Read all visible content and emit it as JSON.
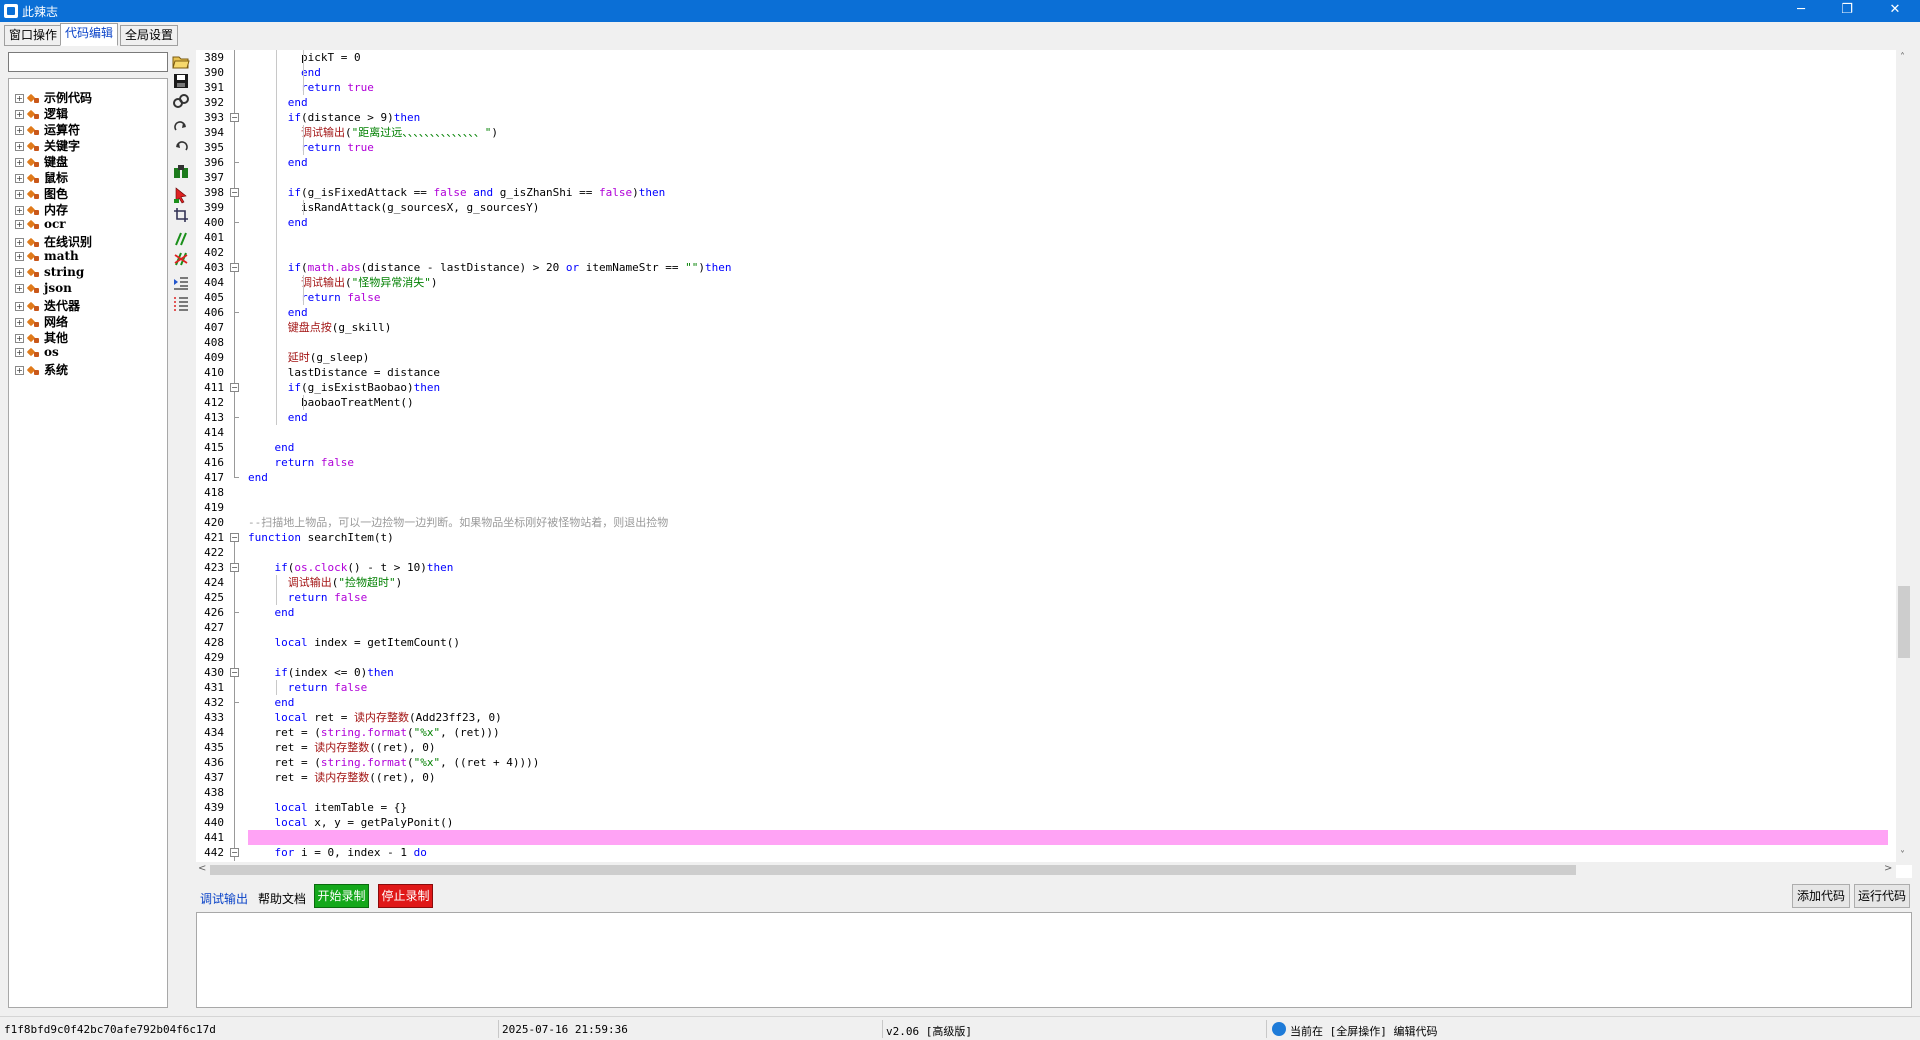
{
  "window": {
    "title": "此辣志",
    "min": "─",
    "max": "❐",
    "close": "✕"
  },
  "tabs": [
    {
      "label": "窗口操作",
      "active": false
    },
    {
      "label": "代码编辑",
      "active": true
    },
    {
      "label": "全局设置",
      "active": false
    }
  ],
  "sidebar": {
    "search_value": "",
    "tree_items": [
      "示例代码",
      "逻辑",
      "运算符",
      "关键字",
      "键盘",
      "鼠标",
      "图色",
      "内存",
      "ocr",
      "在线识别",
      "math",
      "string",
      "json",
      "迭代器",
      "网络",
      "其他",
      "os",
      "系统"
    ]
  },
  "toolbar_icons": [
    "open-icon",
    "save-icon",
    "link-icon",
    "redo-icon",
    "undo-icon",
    "find-icon",
    "pointer-icon",
    "crop-icon",
    "comment-icon",
    "uncomment-icon",
    "indent-icon",
    "list-icon"
  ],
  "editor": {
    "first_line": 389,
    "highlighted_line": 441,
    "lines": [
      [
        [
          "        pickT = 0",
          ""
        ]
      ],
      [
        [
          "        ",
          ""
        ],
        [
          "end",
          "kw"
        ]
      ],
      [
        [
          "        ",
          ""
        ],
        [
          "return",
          "kw"
        ],
        [
          " ",
          ""
        ],
        [
          "true",
          "kw2"
        ]
      ],
      [
        [
          "      ",
          ""
        ],
        [
          "end",
          "kw"
        ]
      ],
      [
        [
          "      ",
          ""
        ],
        [
          "if",
          "kw"
        ],
        [
          "(distance > 9)",
          ""
        ],
        [
          "then",
          "kw"
        ]
      ],
      [
        [
          "        ",
          ""
        ],
        [
          "调试输出",
          "fn"
        ],
        [
          "(",
          ""
        ],
        [
          "\"距离过远、、、、、、、、、、、、、、\"",
          "str"
        ],
        [
          ")",
          ""
        ]
      ],
      [
        [
          "        ",
          ""
        ],
        [
          "return",
          "kw"
        ],
        [
          " ",
          ""
        ],
        [
          "true",
          "kw2"
        ]
      ],
      [
        [
          "      ",
          ""
        ],
        [
          "end",
          "kw"
        ]
      ],
      [
        [
          "",
          ""
        ]
      ],
      [
        [
          "      ",
          ""
        ],
        [
          "if",
          "kw"
        ],
        [
          "(g_isFixedAttack == ",
          ""
        ],
        [
          "false",
          "kw2"
        ],
        [
          " ",
          ""
        ],
        [
          "and",
          "kw"
        ],
        [
          " g_isZhanShi == ",
          ""
        ],
        [
          "false",
          "kw2"
        ],
        [
          ")",
          ""
        ],
        [
          "then",
          "kw"
        ]
      ],
      [
        [
          "        isRandAttack(g_sourcesX, g_sourcesY)",
          ""
        ]
      ],
      [
        [
          "      ",
          ""
        ],
        [
          "end",
          "kw"
        ]
      ],
      [
        [
          "",
          ""
        ]
      ],
      [
        [
          "",
          ""
        ]
      ],
      [
        [
          "      ",
          ""
        ],
        [
          "if",
          "kw"
        ],
        [
          "(",
          ""
        ],
        [
          "math.abs",
          "kw2"
        ],
        [
          "(distance - lastDistance) > 20 ",
          ""
        ],
        [
          "or",
          "kw"
        ],
        [
          " itemNameStr == ",
          ""
        ],
        [
          "\"\"",
          "str"
        ],
        [
          ")",
          ""
        ],
        [
          "then",
          "kw"
        ]
      ],
      [
        [
          "        ",
          ""
        ],
        [
          "调试输出",
          "fn"
        ],
        [
          "(",
          ""
        ],
        [
          "\"怪物异常消失\"",
          "str"
        ],
        [
          ")",
          ""
        ]
      ],
      [
        [
          "        ",
          ""
        ],
        [
          "return",
          "kw"
        ],
        [
          " ",
          ""
        ],
        [
          "false",
          "kw2"
        ]
      ],
      [
        [
          "      ",
          ""
        ],
        [
          "end",
          "kw"
        ]
      ],
      [
        [
          "      ",
          ""
        ],
        [
          "键盘点按",
          "fn"
        ],
        [
          "(g_skill)",
          ""
        ]
      ],
      [
        [
          "",
          ""
        ]
      ],
      [
        [
          "      ",
          ""
        ],
        [
          "延时",
          "fn"
        ],
        [
          "(g_sleep)",
          ""
        ]
      ],
      [
        [
          "      lastDistance = distance",
          ""
        ]
      ],
      [
        [
          "      ",
          ""
        ],
        [
          "if",
          "kw"
        ],
        [
          "(g_isExistBaobao)",
          ""
        ],
        [
          "then",
          "kw"
        ]
      ],
      [
        [
          "        baobaoTreatMent()",
          ""
        ]
      ],
      [
        [
          "      ",
          ""
        ],
        [
          "end",
          "kw"
        ]
      ],
      [
        [
          "",
          ""
        ]
      ],
      [
        [
          "    ",
          ""
        ],
        [
          "end",
          "kw"
        ]
      ],
      [
        [
          "    ",
          ""
        ],
        [
          "return",
          "kw"
        ],
        [
          " ",
          ""
        ],
        [
          "false",
          "kw2"
        ]
      ],
      [
        [
          "",
          ""
        ],
        [
          "end",
          "kw"
        ]
      ],
      [
        [
          "",
          ""
        ]
      ],
      [
        [
          "",
          ""
        ]
      ],
      [
        [
          "--扫描地上物品，可以一边捡物一边判断。如果物品坐标刚好被怪物站着，则退出捡物",
          "cmt"
        ]
      ],
      [
        [
          "",
          ""
        ],
        [
          "function",
          "kw"
        ],
        [
          " searchItem(t)",
          ""
        ]
      ],
      [
        [
          "",
          ""
        ]
      ],
      [
        [
          "    ",
          ""
        ],
        [
          "if",
          "kw"
        ],
        [
          "(",
          ""
        ],
        [
          "os.clock",
          "kw2"
        ],
        [
          "() - t > 10)",
          ""
        ],
        [
          "then",
          "kw"
        ]
      ],
      [
        [
          "      ",
          ""
        ],
        [
          "调试输出",
          "fn"
        ],
        [
          "(",
          ""
        ],
        [
          "\"捡物超时\"",
          "str"
        ],
        [
          ")",
          ""
        ]
      ],
      [
        [
          "      ",
          ""
        ],
        [
          "return",
          "kw"
        ],
        [
          " ",
          ""
        ],
        [
          "false",
          "kw2"
        ]
      ],
      [
        [
          "    ",
          ""
        ],
        [
          "end",
          "kw"
        ]
      ],
      [
        [
          "",
          ""
        ]
      ],
      [
        [
          "    ",
          ""
        ],
        [
          "local",
          "kw"
        ],
        [
          " index = getItemCount()",
          ""
        ]
      ],
      [
        [
          "",
          ""
        ]
      ],
      [
        [
          "    ",
          ""
        ],
        [
          "if",
          "kw"
        ],
        [
          "(index <= 0)",
          ""
        ],
        [
          "then",
          "kw"
        ]
      ],
      [
        [
          "      ",
          ""
        ],
        [
          "return",
          "kw"
        ],
        [
          " ",
          ""
        ],
        [
          "false",
          "kw2"
        ]
      ],
      [
        [
          "    ",
          ""
        ],
        [
          "end",
          "kw"
        ]
      ],
      [
        [
          "    ",
          ""
        ],
        [
          "local",
          "kw"
        ],
        [
          " ret = ",
          ""
        ],
        [
          "读内存整数",
          "fn"
        ],
        [
          "(Add23ff23, 0)",
          ""
        ]
      ],
      [
        [
          "    ret = (",
          ""
        ],
        [
          "string.format",
          "kw2"
        ],
        [
          "(",
          ""
        ],
        [
          "\"%x\"",
          "str"
        ],
        [
          ", (ret)))",
          ""
        ]
      ],
      [
        [
          "    ret = ",
          ""
        ],
        [
          "读内存整数",
          "fn"
        ],
        [
          "((ret), 0)",
          ""
        ]
      ],
      [
        [
          "    ret = (",
          ""
        ],
        [
          "string.format",
          "kw2"
        ],
        [
          "(",
          ""
        ],
        [
          "\"%x\"",
          "str"
        ],
        [
          ", ((ret + 4))))",
          ""
        ]
      ],
      [
        [
          "    ret = ",
          ""
        ],
        [
          "读内存整数",
          "fn"
        ],
        [
          "((ret), 0)",
          ""
        ]
      ],
      [
        [
          "",
          ""
        ]
      ],
      [
        [
          "    ",
          ""
        ],
        [
          "local",
          "kw"
        ],
        [
          " itemTable = {}",
          ""
        ]
      ],
      [
        [
          "    ",
          ""
        ],
        [
          "local",
          "kw"
        ],
        [
          " x, y = getPalyPonit()",
          ""
        ]
      ],
      [
        [
          "",
          ""
        ]
      ],
      [
        [
          "    ",
          ""
        ],
        [
          "for",
          "kw"
        ],
        [
          " i = 0, index - 1 ",
          ""
        ],
        [
          "do",
          "kw"
        ]
      ]
    ]
  },
  "bottom_tabs": {
    "debug_output": "调试输出",
    "help_docs": "帮助文档"
  },
  "buttons": {
    "start_record": "开始录制",
    "stop_record": "停止录制",
    "add_code": "添加代码",
    "run_code": "运行代码"
  },
  "output": {
    "text": ""
  },
  "status": {
    "hash": "f1f8bfd9c0f42bc70afe792b04f6c17d",
    "datetime": "2025-07-16 21:59:36",
    "version": "v2.06 [高级版]",
    "mode": "当前在 [全屏操作] 编辑代码"
  },
  "colors": {
    "titlebar": "#0b6fd6",
    "highlight_line": "#ffa3f5",
    "keyword": "#0000ff",
    "function": "#a31515",
    "string": "#008000",
    "literal": "#b000d8",
    "comment": "#9a9a9a",
    "start_btn": "#14a81b",
    "stop_btn": "#e01818"
  }
}
